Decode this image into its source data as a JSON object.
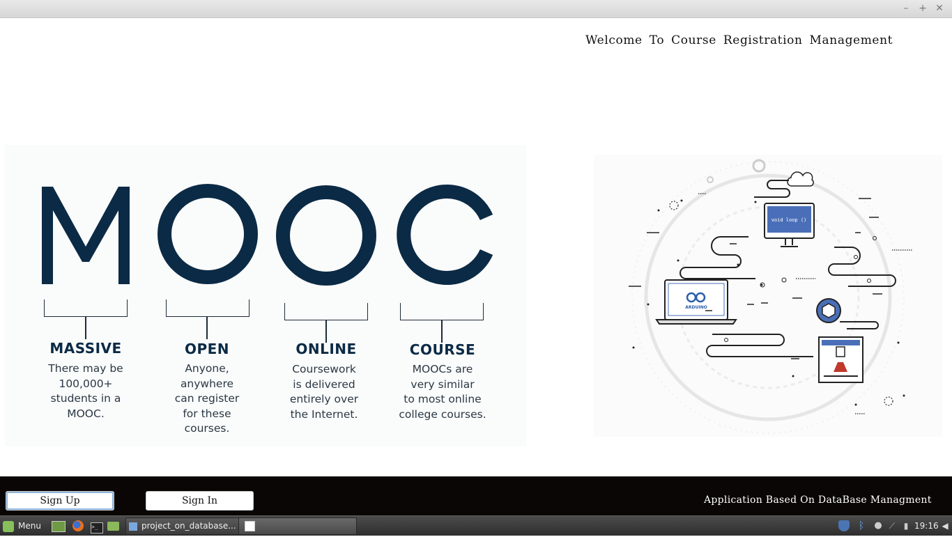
{
  "window": {
    "controls": {
      "minimize": "–",
      "maximize": "+",
      "close": "✕"
    }
  },
  "header": {
    "welcome": "Welcome To Course Registration Management"
  },
  "mooc": {
    "letters": [
      "M",
      "O",
      "O",
      "C"
    ],
    "items": [
      {
        "word": "MASSIVE",
        "lines": [
          "There may be",
          "100,000+",
          "students in a",
          "MOOC."
        ]
      },
      {
        "word": "OPEN",
        "lines": [
          "Anyone,",
          "anywhere",
          "can register",
          "for these",
          "courses."
        ]
      },
      {
        "word": "ONLINE",
        "lines": [
          "Coursework",
          "is delivered",
          "entirely over",
          "the Internet."
        ]
      },
      {
        "word": "COURSE",
        "lines": [
          "MOOCs are",
          "very similar",
          "to most online",
          "college courses."
        ]
      }
    ],
    "color": "#0b2a45"
  },
  "illustration": {
    "monitor_text": "void loop ()",
    "laptop_text": "ARDUINO"
  },
  "footer": {
    "signup_label": "Sign Up",
    "signin_label": "Sign In",
    "note": "Application Based On DataBase Managment"
  },
  "taskbar": {
    "menu_label": "Menu",
    "task1_label": "project_on_database...",
    "clock": "19:16"
  }
}
